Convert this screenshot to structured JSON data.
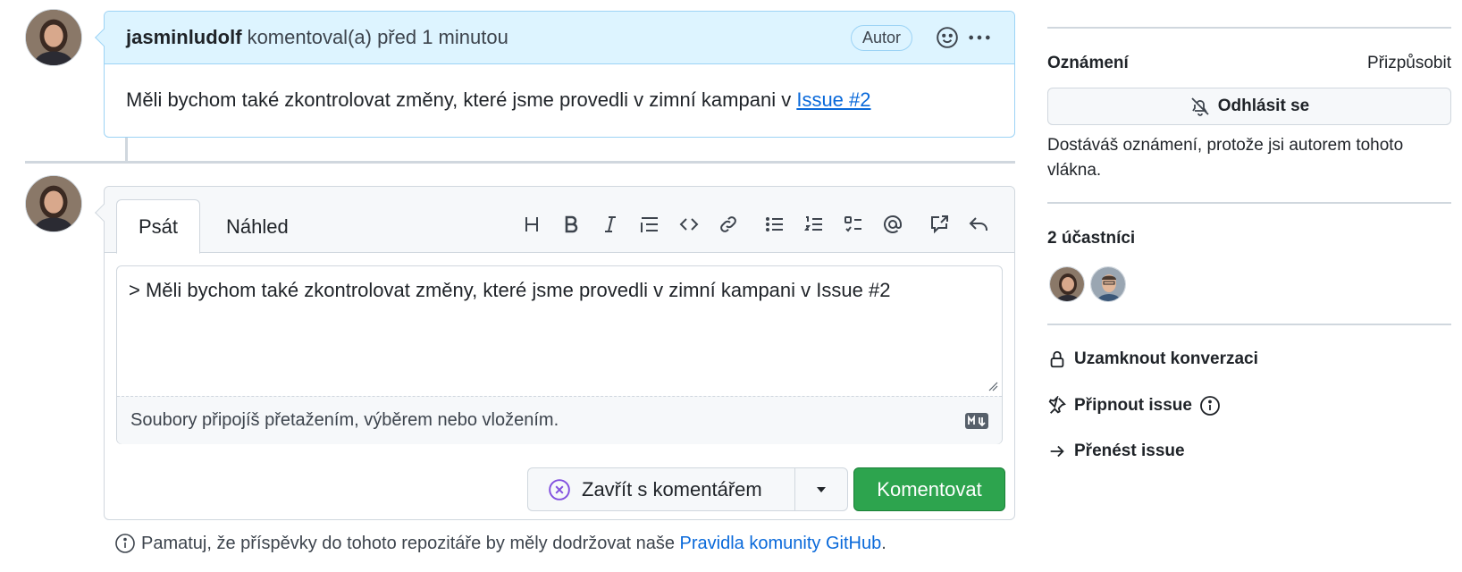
{
  "comment": {
    "author": "jasminludolf",
    "meta": "komentoval(a) před 1 minutou",
    "badge": "Autor",
    "body_text": "Měli bychom také zkontrolovat změny, které jsme provedli v zimní kampani v",
    "body_link": "Issue #2"
  },
  "editor": {
    "tab_write": "Psát",
    "tab_preview": "Náhled",
    "toolbar": [
      "heading-icon",
      "bold-icon",
      "italic-icon",
      "quote-icon",
      "code-icon",
      "link-icon",
      "unordered-list-icon",
      "ordered-list-icon",
      "task-list-icon",
      "mention-icon",
      "cross-reference-icon",
      "reply-icon"
    ],
    "text": "> Měli bychom také zkontrolovat změny, které jsme provedli v zimní kampani v Issue #2",
    "attach_hint": "Soubory připojíš přetažením, výběrem nebo vložením.",
    "close_button": "Zavřít s komentářem",
    "comment_button": "Komentovat",
    "guideline_text": "Pamatuj, že příspěvky do tohoto repozitáře by měly dodržovat naše",
    "guideline_link": "Pravidla komunity GitHub",
    "guideline_end": "."
  },
  "sidebar": {
    "notifications_title": "Oznámení",
    "customize": "Přizpůsobit",
    "unsubscribe": "Odhlásit se",
    "note": "Dostáváš oznámení, protože jsi autorem tohoto vlákna.",
    "participants_title": "2 účastníci",
    "lock": "Uzamknout konverzaci",
    "pin": "Připnout issue",
    "transfer": "Přenést issue"
  },
  "colors": {
    "accent_blue": "#0969da",
    "comment_header_bg": "#ddf4ff",
    "primary_green": "#2da44e",
    "close_icon_purple": "#8250df"
  }
}
